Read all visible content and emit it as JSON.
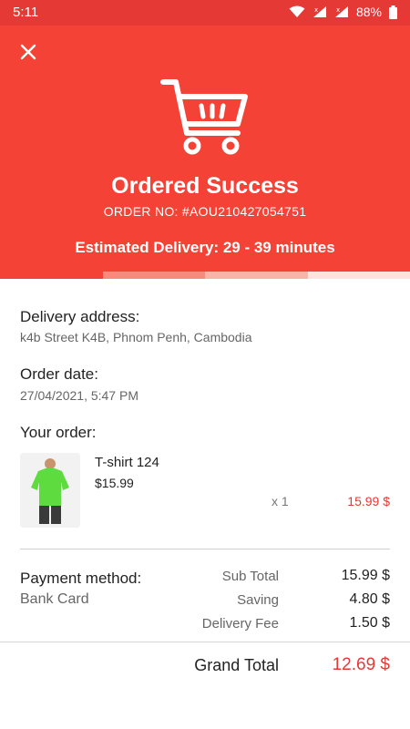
{
  "status_bar": {
    "time": "5:11",
    "battery": "88%"
  },
  "hero": {
    "title": "Ordered Success",
    "order_no": "ORDER NO: #AOU210427054751",
    "delivery": "Estimated Delivery: 29 - 39 minutes",
    "progress_fraction": 0.25
  },
  "delivery_address": {
    "label": "Delivery address:",
    "value": "k4b Street K4B, Phnom Penh, Cambodia"
  },
  "order_date": {
    "label": "Order date:",
    "value": "27/04/2021, 5:47 PM"
  },
  "your_order": {
    "label": "Your order:",
    "items": [
      {
        "name": "T-shirt 124",
        "price": "$15.99",
        "qty": "x 1",
        "total": "15.99 $"
      }
    ]
  },
  "payment": {
    "label": "Payment method:",
    "value": "Bank Card"
  },
  "summary": {
    "sub_total_label": "Sub Total",
    "sub_total_value": "15.99 $",
    "saving_label": "Saving",
    "saving_value": "4.80 $",
    "delivery_fee_label": "Delivery Fee",
    "delivery_fee_value": "1.50 $"
  },
  "grand_total": {
    "label": "Grand Total",
    "value": "12.69 $"
  },
  "colors": {
    "primary": "#f44336",
    "status_bar": "#e53935",
    "price": "#e53935"
  }
}
